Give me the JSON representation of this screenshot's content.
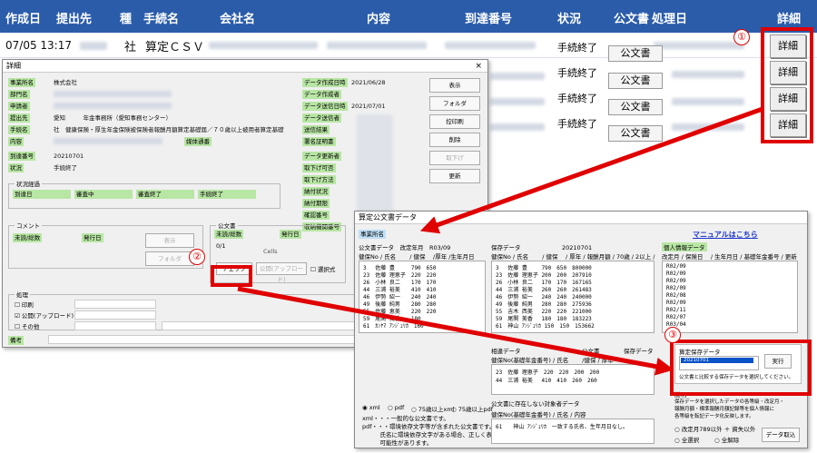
{
  "main": {
    "headers": [
      "作成日",
      "提出先",
      "種",
      "手続名",
      "会社名",
      "内容",
      "到達番号",
      "状況",
      "公文書",
      "処理日",
      "詳細"
    ],
    "rows": [
      {
        "date": "07/05 13:17",
        "shu": "社",
        "tetsuzuki": "算定ＣＳＶ",
        "status": "手続終了",
        "kobun": "公文書",
        "detail": "詳細"
      },
      {
        "date": "",
        "shu": "",
        "tetsuzuki": "",
        "status": "手続終了",
        "kobun": "公文書",
        "detail": "詳細"
      },
      {
        "date": "",
        "shu": "",
        "tetsuzuki": "",
        "status": "手続終了",
        "kobun": "公文書",
        "detail": "詳細"
      },
      {
        "date": "",
        "shu": "",
        "tetsuzuki": "",
        "status": "手続終了",
        "kobun": "公文書",
        "detail": "詳細"
      }
    ]
  },
  "markers": {
    "one": "①",
    "two": "②",
    "three": "③"
  },
  "dlg1": {
    "title": "詳細",
    "close": "×",
    "labels": {
      "jigyosho": "事業所名",
      "busho": "部門名",
      "shinseisha": "申請者",
      "teishutsusaki": "提出先",
      "tetsuzukimei": "手続名",
      "naiyo": "内容",
      "totatsu": "到達番号",
      "jokyo": "状況",
      "data_sakusei": "データ作成日時",
      "data_sakuseisha": "データ作成者",
      "data_soshin": "データ送信日時",
      "data_soshinsha": "データ送信者",
      "soshin_kekka": "送信結果",
      "shomei": "署名証明書",
      "data_koshinsha": "データ更新者",
      "torisage_moshi": "取下げ可否",
      "torisage_hoho": "取下げ方法",
      "nofu_jokyo": "納付状況",
      "nofu_kigen": "納付期限",
      "kakunin": "確認番号",
      "shuno": "収納機関番号",
      "baitai": "媒体通番"
    },
    "values": {
      "jigyosho": "株式会社",
      "teishutsusaki": "愛知　　　年金事務所（愛知事務センター）",
      "tetsuzukimei": "社　健康保険・厚生年金保険被保険者報酬月額算定基礎届／７０歳以上被用者算定基礎",
      "totatsu": "20210701",
      "jokyo": "手続終了",
      "data_sakusei": "2021/06/28",
      "data_soshin": "2021/07/01"
    },
    "buttons": {
      "hyoji": "表示",
      "folder": "フォルダ",
      "hikae": "控印刷",
      "sakujo": "削除",
      "torisage": "取下げ",
      "koshin": "更新"
    },
    "progress": {
      "title": "状況経過",
      "cols": [
        "到達日",
        "審査中",
        "審査終了",
        "手続終了"
      ]
    },
    "comment": {
      "title": "コメント",
      "misetsu": "未読/総数",
      "hakko": "発行日",
      "hyoji": "表示",
      "folder": "フォルダ"
    },
    "kobun": {
      "title": "公文書",
      "misetsu": "未読/総数",
      "hakko": "発行日",
      "count": "0/1",
      "cells": "Cells",
      "check": "チェック",
      "kobun_up": "公開(アップロード)",
      "sentaku": "選択式"
    },
    "shori": {
      "title": "処理",
      "insatsu": "印刷",
      "kokai": "公開(アップロード)",
      "sonota": "その他"
    },
    "biko": "備考"
  },
  "dlg2": {
    "title": "算定公文書データ",
    "jigyosho_label": "事業所名",
    "manual": "マニュアルはこちら",
    "kobun_header": "公文書データ　改定年月　R03/09",
    "kobun_cols": "健保No / 氏名　　 / 健保　 /厚年 /生年月日",
    "hozon_header": "保存データ　　　　　　　20210701",
    "hozon_cols": "健保No / 氏名　　 / 健保　 / 厚年 / 報酬月額 / 70歳 / 2以上 /",
    "kojin_header": "個人情報データ",
    "kojin_cols": "改定月 / 保険日　 / 生年月日 / 基礎年金番号 / 更新",
    "kobun_rows": [
      "3　 佐藤 豊　　　790　650",
      "23　佐藤 理恵子　220　220",
      "26　小林 良二　　170　170",
      "44　三浦 裕美　　410　410",
      "46　伊勢 紹一　　240　240",
      "49　後藤 純男　　280　280",
      "55　佐藤 恵美　　220　220",
      "59　尾関 美香　　180",
      "61　ｶﾝﾔﾏ ｱﾝｼﾞｪﾘｶ　160"
    ],
    "hozon_rows": [
      "3　 佐藤 豊　　 790　650　800000",
      "23　佐藤 理恵子 200　200　207910",
      "26　小林 良二　 170　170　167165",
      "44　三浦 裕美　 260　260　261483",
      "46　伊勢 紹一　 240　240　240000",
      "49　後藤 純男　 280　280　275936",
      "55　吉木 西美　 220　220　221000",
      "59　尾関 美香　 180　180　183223",
      "61　神山 ｱﾝｼﾞｪﾘｶ 150　150　153662"
    ],
    "kojin_rows": [
      "R02/09",
      "R02/09",
      "R02/09",
      "R02/09",
      "R02/08",
      "R02/09",
      "R02/11",
      "R02/07",
      "R03/04"
    ],
    "soi_header": "相違データ",
    "soi_sub1": "公文書",
    "soi_sub2": "保存データ",
    "soi_cols": "健保No(基礎年金番号) / 氏名　　 /健保 / 厚年",
    "soi_rows": [
      "23　佐藤 理恵子　220　220　200　200",
      "44　三浦 裕美　 410　410　260　260"
    ],
    "format": {
      "xml": "xml",
      "pdf": "pdf",
      "r75xml": "75歳以上xml",
      "r75pdf": "75歳以上pdf"
    },
    "notes": [
      "xml・・・一般的な公文書です。",
      "pdf・・・環境依存文字等が含まれた公文書です。",
      "　　　氏名に環境依存文字がある場合、正しく表示されない",
      "　　　可能性があります。"
    ],
    "nai_header": "公文書に存在しない対象者データ",
    "nai_cols": "健保No(基礎年金番号) / 氏名 / 内容",
    "nai_rows": [
      "61　　神山 ｱﾝｼﾞｪﾘｶ　一致する氏名、生年月日なし。"
    ],
    "santei_title": "算定保存データ",
    "santei_value": "20210701",
    "jikko": "実行",
    "santei_note": "公文書と比較する保存データを選択してください。",
    "explain_title": "説明",
    "explain": [
      "保存データを選択したデータの各等級・改定月・",
      "報酬月額・標準報酬月額記録等を個人情報に",
      "各等級を転記データ化反映します。"
    ],
    "opt1": "改定月789以外 ＋ 資失以外",
    "opt2": "全選択",
    "opt3": "全解除",
    "data_btn": "データ取込"
  }
}
